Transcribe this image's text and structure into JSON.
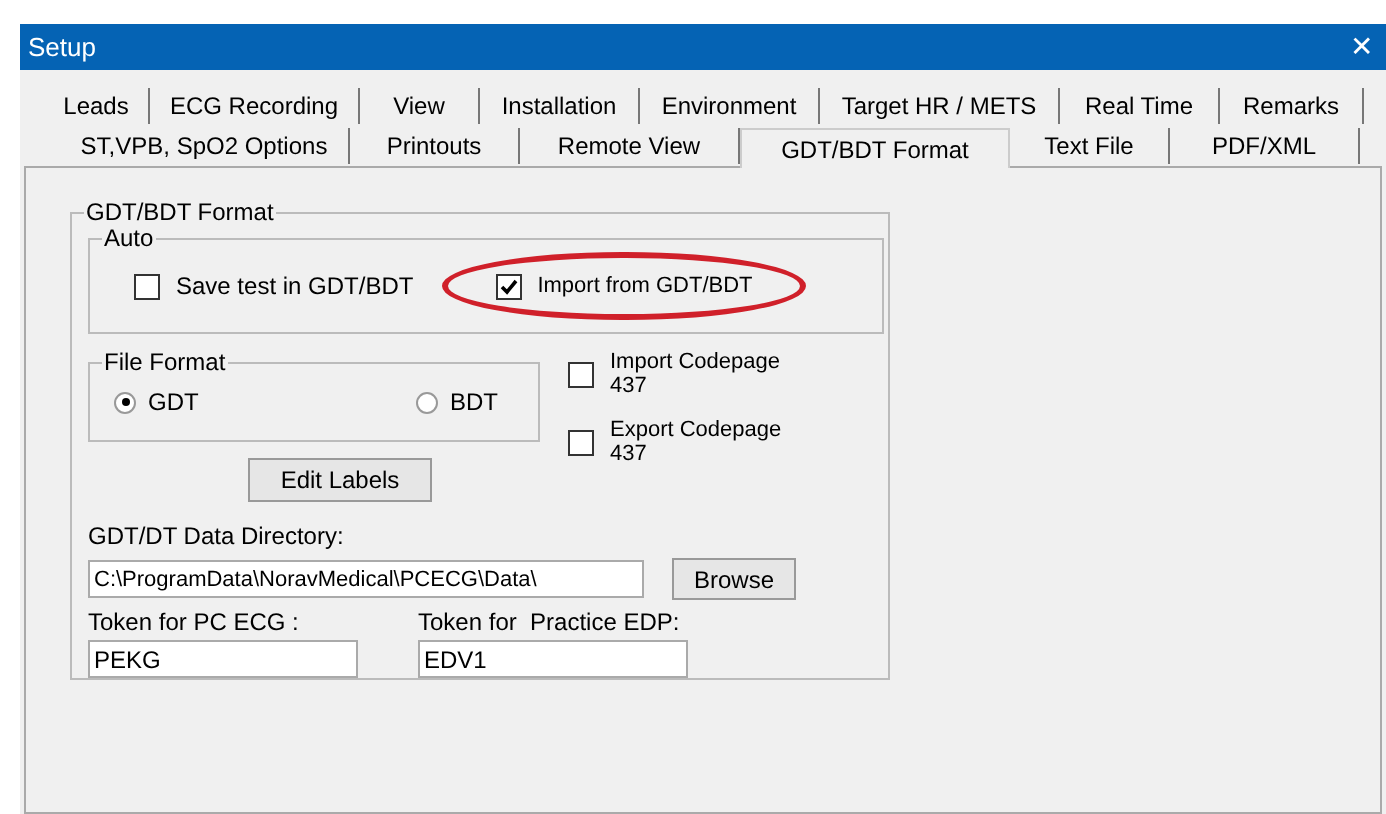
{
  "window": {
    "title": "Setup",
    "close": "✕"
  },
  "tab_rows": [
    [
      {
        "label": "Leads",
        "selected": false
      },
      {
        "label": "ECG Recording",
        "selected": false
      },
      {
        "label": "View",
        "selected": false
      },
      {
        "label": "Installation",
        "selected": false
      },
      {
        "label": "Environment",
        "selected": false
      },
      {
        "label": "Target HR / METS",
        "selected": false
      },
      {
        "label": "Real Time",
        "selected": false
      },
      {
        "label": "Remarks",
        "selected": false
      }
    ],
    [
      {
        "label": "ST,VPB, SpO2 Options",
        "selected": false
      },
      {
        "label": "Printouts",
        "selected": false
      },
      {
        "label": "Remote View",
        "selected": false
      },
      {
        "label": "GDT/BDT Format",
        "selected": true
      },
      {
        "label": "Text File",
        "selected": false
      },
      {
        "label": "PDF/XML",
        "selected": false
      }
    ]
  ],
  "group": {
    "title": "GDT/BDT Format",
    "auto": {
      "title": "Auto",
      "checkboxes": [
        {
          "label": "Save test in GDT/BDT",
          "checked": false,
          "highlighted": false
        },
        {
          "label": "Import from GDT/BDT",
          "checked": true,
          "highlighted": true
        }
      ]
    },
    "file_format": {
      "title": "File Format",
      "radios": [
        {
          "label": "GDT",
          "selected": true
        },
        {
          "label": "BDT",
          "selected": false
        }
      ]
    },
    "codepages": [
      {
        "label": "Import Codepage",
        "value": "437",
        "checked": false
      },
      {
        "label": "Export Codepage",
        "value": "437",
        "checked": false
      }
    ],
    "edit_labels_button": "Edit Labels",
    "directory": {
      "label": "GDT/DT Data Directory:",
      "value": "C:\\ProgramData\\NoravMedical\\PCECG\\Data\\",
      "button": "Browse"
    },
    "tokens": [
      {
        "label": "Token for PC ECG :",
        "value": "PEKG"
      },
      {
        "label": "Token for  Practice EDP:",
        "value": "EDV1"
      }
    ]
  }
}
